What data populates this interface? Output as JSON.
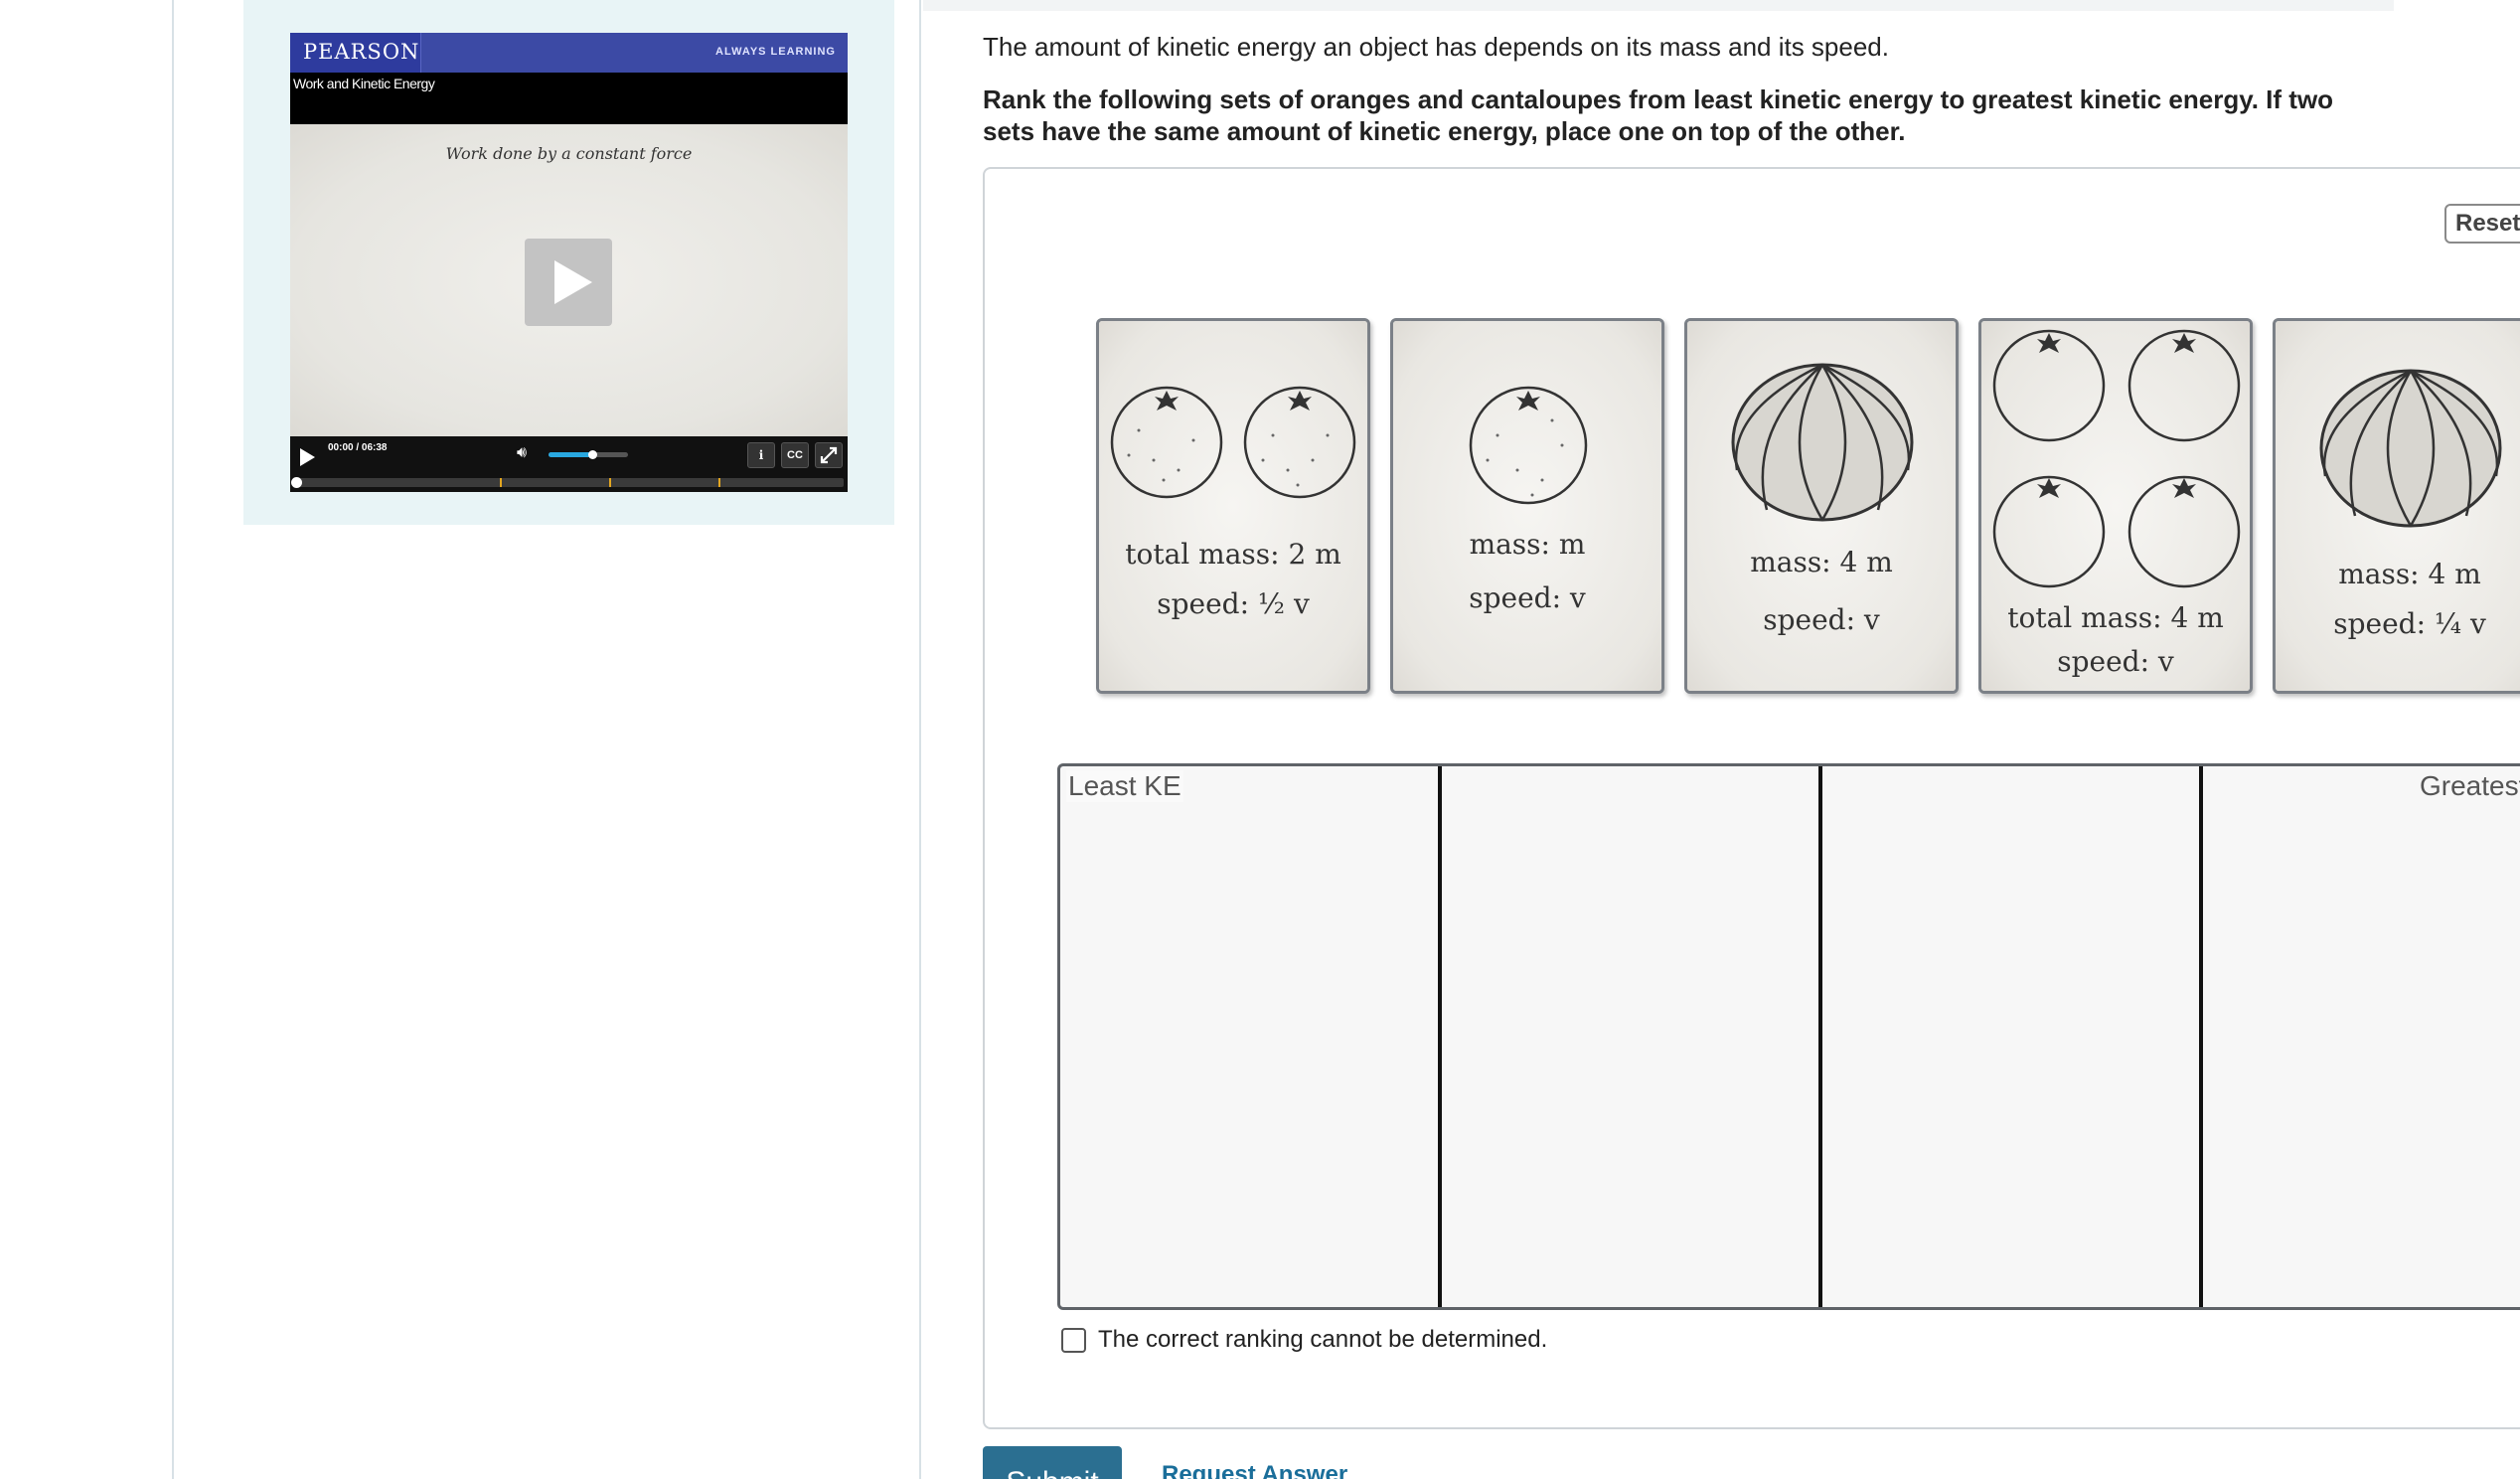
{
  "video": {
    "brand": "PEARSON",
    "tagline": "ALWAYS LEARNING",
    "title": "Work and Kinetic Energy",
    "caption": "Work done by a constant force",
    "time": "00:00 / 06:38",
    "volume_level": 0.55,
    "info_label": "i",
    "cc_label": "CC"
  },
  "question": {
    "intro": "The amount of kinetic energy an object has depends on its mass and its speed.",
    "instruction": "Rank the following sets of oranges and cantaloupes from least kinetic energy to greatest kinetic energy. If two sets have the same amount of kinetic energy, place one on top of the other."
  },
  "widget": {
    "reset_label": "Reset",
    "least_label": "Least KE",
    "greatest_label": "Greatest KE",
    "undetermined_label": "The correct ranking cannot be determined.",
    "cards": [
      {
        "line1": "total mass: 2 m",
        "line2": "speed: ½ v"
      },
      {
        "line1": "mass: m",
        "line2": "speed: v"
      },
      {
        "line1": "mass: 4 m",
        "line2": "speed: v"
      },
      {
        "line1": "total mass: 4 m",
        "line2": "speed: v"
      },
      {
        "line1": "mass: 4 m",
        "line2": "speed: ¼ v"
      }
    ]
  },
  "actions": {
    "submit_label": "Submit",
    "request_answer_label": "Request Answer"
  }
}
